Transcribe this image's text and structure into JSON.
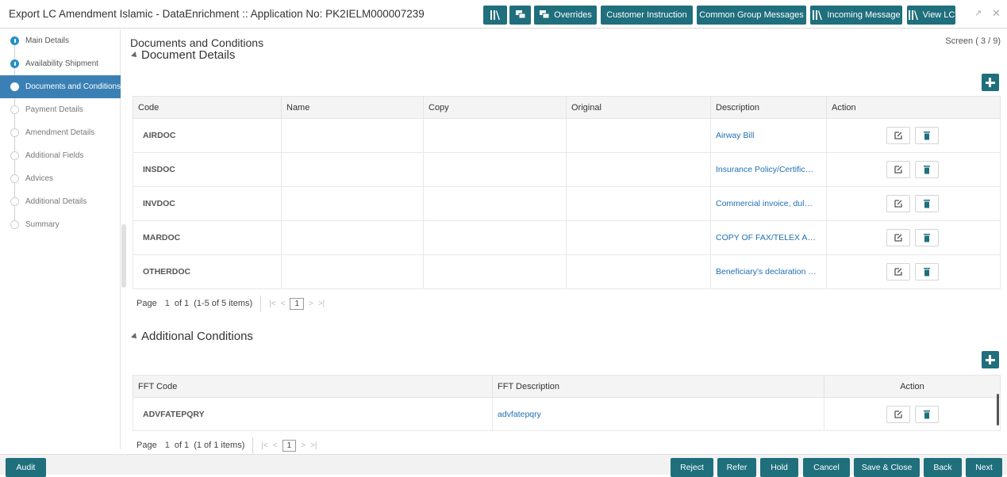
{
  "header": {
    "title": "Export LC Amendment Islamic - DataEnrichment :: Application No: PK2IELM000007239",
    "buttons": {
      "overrides": "Overrides",
      "customer_instruction": "Customer Instruction",
      "common_group_messages": "Common Group Messages",
      "incoming_message": "Incoming Message",
      "view_lc": "View LC"
    },
    "icons": [
      "library-icon",
      "chat-icon",
      "overrides-icon",
      "library-icon",
      "library-icon",
      "maximize-icon",
      "close-icon"
    ],
    "accent_color": "#1f6f7d"
  },
  "sidebar": {
    "items": [
      {
        "label": "Main Details",
        "state": "done"
      },
      {
        "label": "Availability Shipment",
        "state": "done"
      },
      {
        "label": "Documents and Conditions",
        "state": "active"
      },
      {
        "label": "Payment Details",
        "state": "pending"
      },
      {
        "label": "Amendment Details",
        "state": "pending"
      },
      {
        "label": "Additional Fields",
        "state": "pending"
      },
      {
        "label": "Advices",
        "state": "pending"
      },
      {
        "label": "Additional Details",
        "state": "pending"
      },
      {
        "label": "Summary",
        "state": "pending"
      }
    ],
    "active_color": "#3b80b5"
  },
  "main": {
    "page_title": "Documents and Conditions",
    "screen_indicator": "Screen ( 3 / 9)",
    "document_details": {
      "heading": "Document Details",
      "columns": [
        "Code",
        "Name",
        "Copy",
        "Original",
        "Description",
        "Action"
      ],
      "rows": [
        {
          "code": "AIRDOC",
          "name": "",
          "copy": "",
          "original": "",
          "description": "Airway Bill"
        },
        {
          "code": "INSDOC",
          "name": "",
          "copy": "",
          "original": "",
          "description": "Insurance Policy/Certificate i..."
        },
        {
          "code": "INVDOC",
          "name": "",
          "copy": "",
          "original": "",
          "description": "Commercial invoice, duly si..."
        },
        {
          "code": "MARDOC",
          "name": "",
          "copy": "",
          "original": "",
          "description": "COPY OF FAX/TELEX ADVISI..."
        },
        {
          "code": "OTHERDOC",
          "name": "",
          "copy": "",
          "original": "",
          "description": "Beneficiary's declaration sta..."
        }
      ],
      "pager": {
        "page_label": "Page",
        "page": "1",
        "of": "of 1",
        "range": "(1-5 of 5 items)",
        "current": "1"
      }
    },
    "additional_conditions": {
      "heading": "Additional Conditions",
      "columns": [
        "FFT Code",
        "FFT Description",
        "Action"
      ],
      "rows": [
        {
          "code": "ADVFATEPQRY",
          "description": "advfatepqry"
        }
      ],
      "pager": {
        "page_label": "Page",
        "page": "1",
        "of": "of 1",
        "range": "(1 of 1 items)",
        "current": "1"
      }
    }
  },
  "footer": {
    "audit": "Audit",
    "reject": "Reject",
    "refer": "Refer",
    "hold": "Hold",
    "cancel": "Cancel",
    "save_close": "Save & Close",
    "back": "Back",
    "next": "Next"
  }
}
